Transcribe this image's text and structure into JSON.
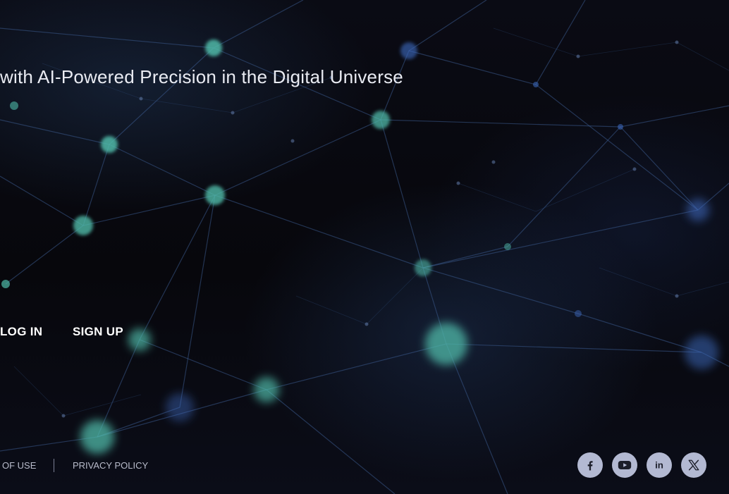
{
  "hero": {
    "tagline": "with AI-Powered Precision in the Digital Universe"
  },
  "auth": {
    "login_label": "LOG IN",
    "signup_label": "SIGN UP"
  },
  "footer": {
    "terms_label": "OF USE",
    "privacy_label": "PRIVACY POLICY"
  },
  "social": {
    "icons": [
      "facebook-icon",
      "youtube-icon",
      "linkedin-icon",
      "x-icon"
    ],
    "linkedin_text": "in"
  },
  "colors": {
    "background": "#08080f",
    "node": "#4fb9a8",
    "line": "#3a5a8c",
    "social_button": "#b3b9d2",
    "social_glyph": "#1c1e2a"
  }
}
